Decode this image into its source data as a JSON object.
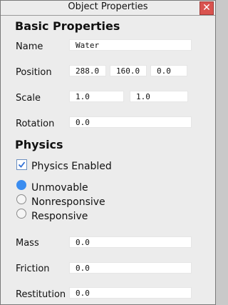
{
  "window": {
    "title": "Object Properties",
    "close_glyph": "✕"
  },
  "basic": {
    "heading": "Basic Properties",
    "name_label": "Name",
    "name_value": "Water",
    "position_label": "Position",
    "position_x": "288.0",
    "position_y": "160.0",
    "position_z": "0.0",
    "scale_label": "Scale",
    "scale_x": "1.0",
    "scale_y": "1.0",
    "rotation_label": "Rotation",
    "rotation_value": "0.0"
  },
  "physics": {
    "heading": "Physics",
    "enabled_label": "Physics Enabled",
    "enabled": true,
    "options": [
      {
        "label": "Unmovable",
        "selected": true
      },
      {
        "label": "Nonresponsive",
        "selected": false
      },
      {
        "label": "Responsive",
        "selected": false
      }
    ],
    "mass_label": "Mass",
    "mass_value": "0.0",
    "friction_label": "Friction",
    "friction_value": "0.0",
    "restitution_label": "Restitution",
    "restitution_value": "0.0"
  },
  "colors": {
    "accent": "#3b8df0",
    "close": "#d9534f"
  }
}
